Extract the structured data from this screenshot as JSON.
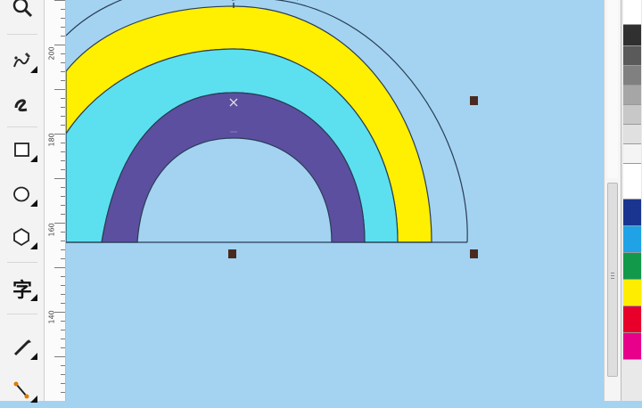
{
  "toolbox": {
    "tools": [
      {
        "name": "zoom-tool",
        "icon": "magnifier-icon",
        "has_flyout": false
      },
      {
        "name": "freehand-tool",
        "icon": "freehand-icon",
        "has_flyout": true
      },
      {
        "name": "smart-drawing-tool",
        "icon": "smart-curve-icon",
        "has_flyout": false
      },
      {
        "name": "rectangle-tool",
        "icon": "rectangle-icon",
        "has_flyout": true
      },
      {
        "name": "ellipse-tool",
        "icon": "ellipse-icon",
        "has_flyout": true
      },
      {
        "name": "polygon-tool",
        "icon": "polygon-icon",
        "has_flyout": true
      },
      {
        "name": "text-tool",
        "icon": "text-icon",
        "label": "字",
        "has_flyout": true
      },
      {
        "name": "dimension-tool",
        "icon": "dimension-icon",
        "has_flyout": true
      },
      {
        "name": "connector-tool",
        "icon": "connector-icon",
        "has_flyout": true
      }
    ]
  },
  "ruler": {
    "labels": [
      "200",
      "180",
      "160",
      "140"
    ]
  },
  "canvas": {
    "background": "#a3d3f1",
    "rainbow_colors": {
      "outer": "#ffef00",
      "middle": "#5ce0f0",
      "inner": "#5c4fa0",
      "outline": "#2a3c55"
    },
    "selection_handle_color": "#4a2a20"
  },
  "palette": {
    "colors": [
      "#ffffff",
      "#303030",
      "#5a5a5a",
      "#808080",
      "#a6a6a6",
      "#c8c8c8",
      "#e0e0e0",
      "#f4f4f4",
      "#ffffff",
      "#1a3590",
      "#1fa3e6",
      "#129a4a",
      "#ffed00",
      "#e8002a",
      "#e8008a"
    ]
  }
}
